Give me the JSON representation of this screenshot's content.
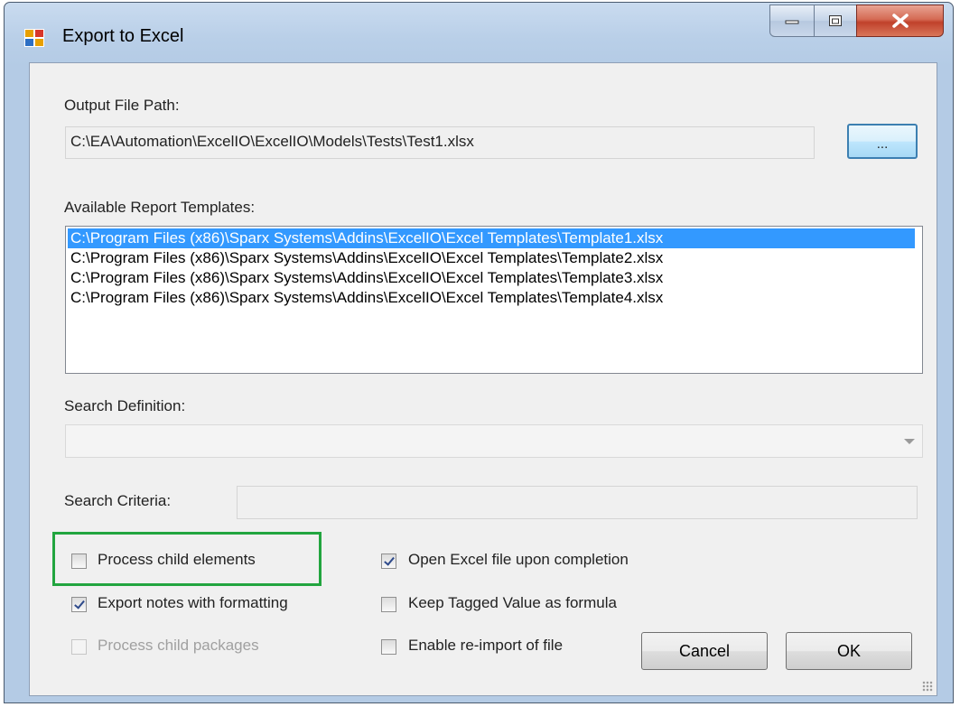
{
  "window": {
    "title": "Export to Excel",
    "icon": "app-icon",
    "controls": [
      "minimize-icon",
      "maximize-icon",
      "close-icon"
    ]
  },
  "output": {
    "label": "Output File Path:",
    "value": "C:\\EA\\Automation\\ExcelIO\\ExcelIO\\Models\\Tests\\Test1.xlsx",
    "browse_label": "..."
  },
  "templates": {
    "label": "Available Report Templates:",
    "items": [
      "C:\\Program Files (x86)\\Sparx Systems\\Addins\\ExcelIO\\Excel Templates\\Template1.xlsx",
      "C:\\Program Files (x86)\\Sparx Systems\\Addins\\ExcelIO\\Excel Templates\\Template2.xlsx",
      "C:\\Program Files (x86)\\Sparx Systems\\Addins\\ExcelIO\\Excel Templates\\Template3.xlsx",
      "C:\\Program Files (x86)\\Sparx Systems\\Addins\\ExcelIO\\Excel Templates\\Template4.xlsx"
    ],
    "selected_index": 0
  },
  "search_definition": {
    "label": "Search Definition:",
    "value": ""
  },
  "search_criteria": {
    "label": "Search Criteria:",
    "value": ""
  },
  "options": {
    "process_child_elements": {
      "label": "Process child elements",
      "checked": false,
      "enabled": true
    },
    "export_notes": {
      "label": "Export notes with formatting",
      "checked": true,
      "enabled": true
    },
    "process_child_packages": {
      "label": "Process child packages",
      "checked": false,
      "enabled": false
    },
    "open_excel": {
      "label": "Open Excel file upon completion",
      "checked": true,
      "enabled": true
    },
    "keep_tagged": {
      "label": "Keep Tagged Value as formula",
      "checked": false,
      "enabled": true
    },
    "enable_reimport": {
      "label": "Enable re-import of file",
      "checked": false,
      "enabled": true
    }
  },
  "buttons": {
    "cancel": "Cancel",
    "ok": "OK"
  },
  "colors": {
    "highlight": "#22a53f",
    "selection": "#3399ff",
    "close_button": "#c0412b"
  }
}
